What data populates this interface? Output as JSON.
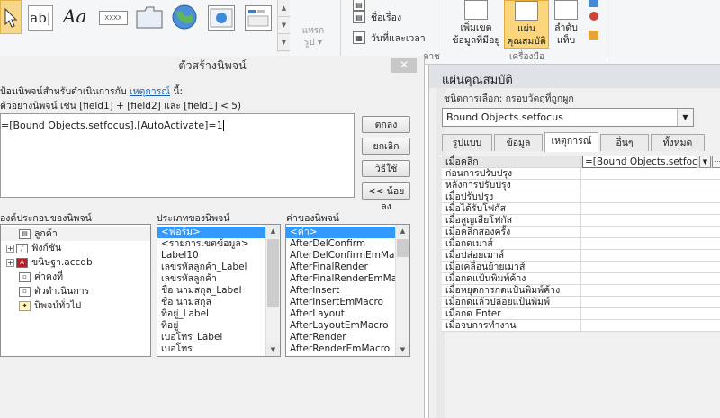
{
  "ribbon": {
    "icons": [
      "select-pointer-icon",
      "textbox-ab-icon",
      "label-aa-icon",
      "button-xxxx-icon",
      "tab-control-icon",
      "hyperlink-globe-icon",
      "web-browser-icon",
      "navigation-icon"
    ],
    "textbox_glyph": "ab|",
    "label_glyph": "Aa",
    "button_glyph": "XXXX",
    "insert_label": "แทรก\nรูป",
    "insert_label_line1": "แทรก",
    "insert_label_line2": "รูป ▾",
    "header_items": [
      "ชื่อเรื่อง",
      "วันที่และเวลา"
    ],
    "section_partial": "ตาช",
    "add_fields_line1": "เพิ่มเขต",
    "add_fields_line2": "ข้อมูลที่มีอยู่",
    "property_sheet_line1": "แผ่น",
    "property_sheet_line2": "คุณสมบัติ",
    "tab_order_line1": "ลำดับ",
    "tab_order_line2": "แท็บ",
    "tools_group": "เครื่องมือ"
  },
  "builder": {
    "title": "ตัวสร้างนิพจน์",
    "close": "✕",
    "instr_prefix": "ป้อนนิพจน์สำหรับดำเนินการกับ ",
    "instr_link": "เหตุการณ์",
    "instr_suffix": " นี้:",
    "example": "ตัวอย่างนิพจน์ เช่น [field1] + [field2] และ [field1] < 5)",
    "expression": "=[Bound Objects.setfocus].[AutoActivate]=1",
    "buttons": {
      "ok": "ตกลง",
      "cancel": "ยกเลิก",
      "help": "วิธีใช้",
      "less": "<< น้อยลง"
    },
    "elements_label": "องค์ประกอบของนิพจน์",
    "categories_label": "ประเภทของนิพจน์",
    "values_label": "ค่าของนิพจน์",
    "elements": [
      "ลูกค้า",
      "ฟังก์ชัน",
      "ขนิษฐา.accdb",
      "ค่าคงที่",
      "ตัวดำเนินการ",
      "นิพจน์ทั่วไป"
    ],
    "categories": [
      "<ฟอร์ม>",
      "<รายการเขตข้อมูล>",
      "Label10",
      "เลขรหัสลูกค้า_Label",
      "เลขรหัสลูกค้า",
      "ชื่อ นามสกุล_Label",
      "ชื่อ นามสกุล",
      "ที่อยู่_Label",
      "ที่อยู่",
      "เบอโทร_Label",
      "เบอโทร"
    ],
    "values": [
      "<ค่า>",
      "AfterDelConfirm",
      "AfterDelConfirmEmMacro",
      "AfterFinalRender",
      "AfterFinalRenderEmMacro",
      "AfterInsert",
      "AfterInsertEmMacro",
      "AfterLayout",
      "AfterLayoutEmMacro",
      "AfterRender",
      "AfterRenderEmMacro"
    ]
  },
  "props": {
    "title": "แผ่นคุณสมบัติ",
    "selection_type": "ชนิดการเลือก:  กรอบวัตถุที่ถูกผูก",
    "object": "Bound Objects.setfocus",
    "tabs": [
      "รูปแบบ",
      "ข้อมูล",
      "เหตุการณ์",
      "อื่นๆ",
      "ทั้งหมด"
    ],
    "rows": [
      "เมื่อคลิก",
      "ก่อนการปรับปรุง",
      "หลังการปรับปรุง",
      "เมื่อปรับปรุง",
      "เมื่อได้รับโฟกัส",
      "เมื่อสูญเสียโฟกัส",
      "เมื่อคลิกสองครั้ง",
      "เมื่อกดเมาส์",
      "เมื่อปล่อยเมาส์",
      "เมื่อเคลื่อนย้ายเมาส์",
      "เมื่อกดแป้นพิมพ์ค้าง",
      "เมื่อหยุดการกดแป้นพิมพ์ค้าง",
      "เมื่อกดแล้วปล่อยแป้นพิมพ์",
      "เมื่อกด Enter",
      "เมื่อจบการทำงาน"
    ],
    "onclick_value": "=[Bound Objects.setfocus"
  },
  "colors": {
    "selection": "#3399ff",
    "ribbon_active": "#fbd67c",
    "link": "#1a5fb4"
  }
}
